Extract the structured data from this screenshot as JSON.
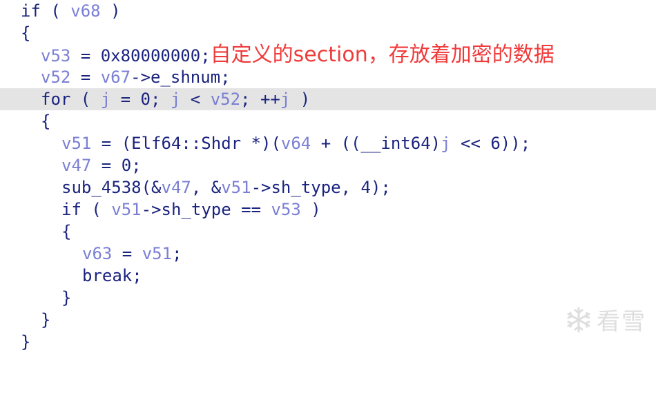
{
  "code": {
    "line1": {
      "kw": "if",
      "open": " ( ",
      "var": "v68",
      "close": " )"
    },
    "line2": {
      "text": "{"
    },
    "line3": {
      "var": "v53",
      "rest": " = 0x80000000;",
      "comment": "自定义的section，存放着加密的数据"
    },
    "line4": {
      "var1": "v52",
      "mid": " = ",
      "var2": "v67",
      "rest": "->e_shnum;"
    },
    "line5": {
      "kw": "for",
      "p1": " ( ",
      "var1": "j",
      "p2": " = 0; ",
      "var2": "j",
      "p3": " < ",
      "var3": "v52",
      "p4": "; ++",
      "var4": "j",
      "p5": " )"
    },
    "line6": {
      "text": "{"
    },
    "line7": {
      "var1": "v51",
      "p1": " = (Elf64::Shdr *)(",
      "var2": "v64",
      "p2": " + ((__int64)",
      "var3": "j",
      "p3": " << 6));"
    },
    "line8": {
      "var": "v47",
      "rest": " = 0;"
    },
    "line9": {
      "p1": "sub_4538(&",
      "var1": "v47",
      "p2": ", &",
      "var2": "v51",
      "p3": "->sh_type, 4);"
    },
    "line10": {
      "kw": "if",
      "p1": " ( ",
      "var1": "v51",
      "p2": "->sh_type == ",
      "var2": "v53",
      "p3": " )"
    },
    "line11": {
      "text": "{"
    },
    "line12": {
      "var1": "v63",
      "p1": " = ",
      "var2": "v51",
      "p2": ";"
    },
    "line13": {
      "kw": "break",
      "p1": ";"
    },
    "line14": {
      "text": "}"
    },
    "line15": {
      "text": "}"
    },
    "line16": {
      "text": "}"
    }
  },
  "watermark": {
    "text": "看雪",
    "icon": "snowflake-icon"
  },
  "colors": {
    "keyword": "#1a237e",
    "variable": "#7a7fd4",
    "comment": "#f03a3a",
    "highlight": "#e4e4e4"
  }
}
